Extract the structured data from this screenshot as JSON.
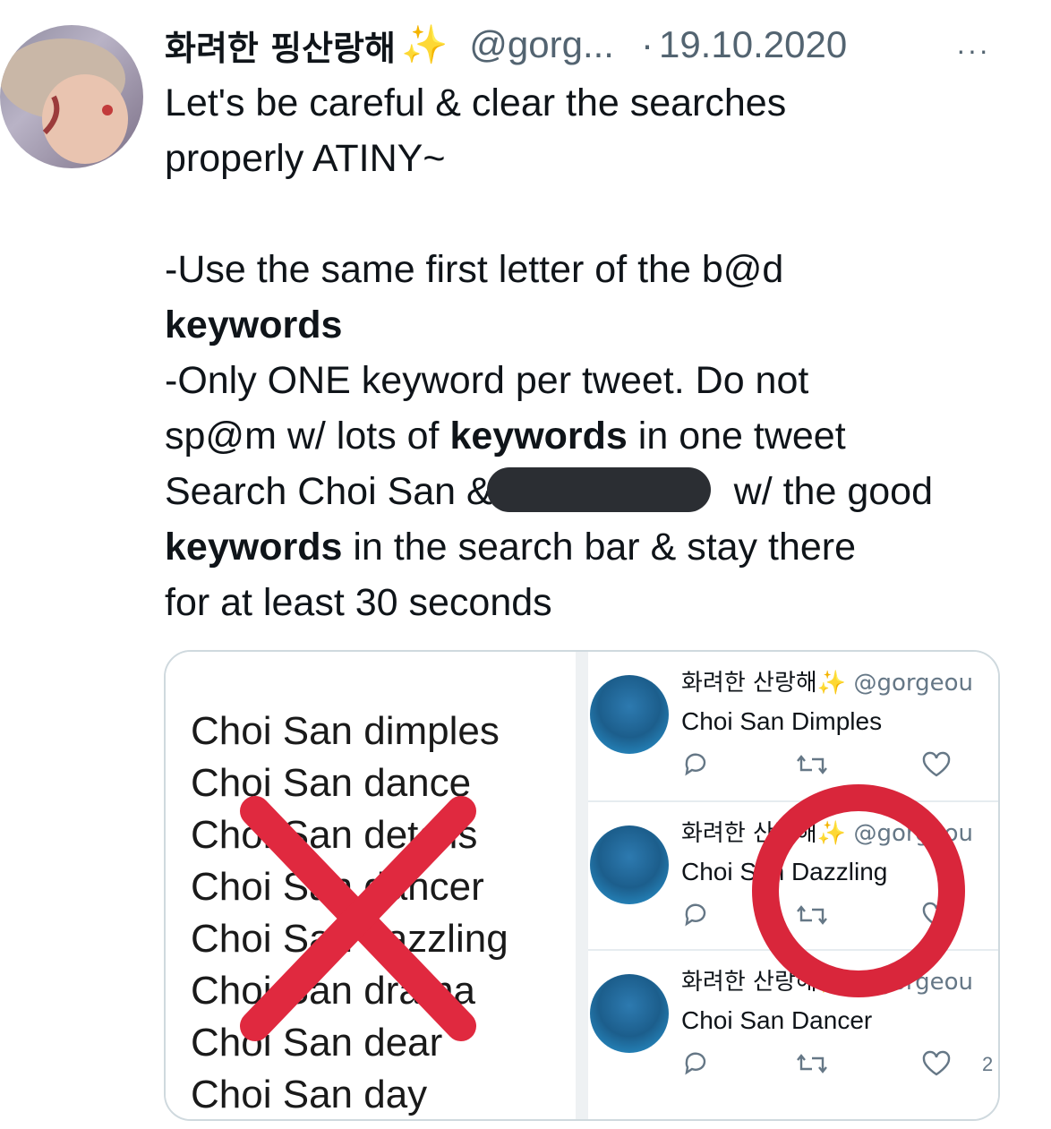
{
  "tweet": {
    "display_name": "화려한 핑산랑해",
    "emoji": "✨",
    "handle": "@gorg...",
    "separator": "·",
    "date": "19.10.2020",
    "more": "···",
    "text": {
      "line1": "Let's be careful & clear the searches",
      "line2": "properly ATINY~",
      "line3": "-Use the same first letter of the b@d",
      "line4_bold": "keywords",
      "line5": "-Only ONE keyword per tweet. Do not",
      "line6_pre": "sp@m w/ lots of ",
      "line6_bold": "keywords",
      "line6_post": " in one tweet",
      "line7_pre": "Search Choi San &",
      "line7_post": " w/ the good",
      "line8_bold": "keywords",
      "line8_post": " in the search bar & stay there",
      "line9": "for at least 30 seconds"
    }
  },
  "media": {
    "bad_list": [
      "Choi San dimples",
      "Choi San dance",
      "Choi San details",
      "Choi San dancer",
      "Choi San dazzling",
      "Choi San drama",
      "Choi San dear",
      "Choi San day"
    ],
    "good_tweets": [
      {
        "name": "화려한 산랑해",
        "emoji": "✨",
        "handle": "@gorgeou",
        "text": "Choi San Dimples",
        "likes": ""
      },
      {
        "name": "화려한 산랑해",
        "emoji": "✨",
        "handle": "@gorgeou",
        "text": "Choi San Dazzling",
        "likes": ""
      },
      {
        "name": "화려한 산랑해",
        "emoji": "✨",
        "handle": "@gorgeou",
        "text": "Choi San Dancer",
        "likes": "2"
      }
    ],
    "colors": {
      "cross": "#e0293f",
      "circle": "#d9263b"
    }
  }
}
